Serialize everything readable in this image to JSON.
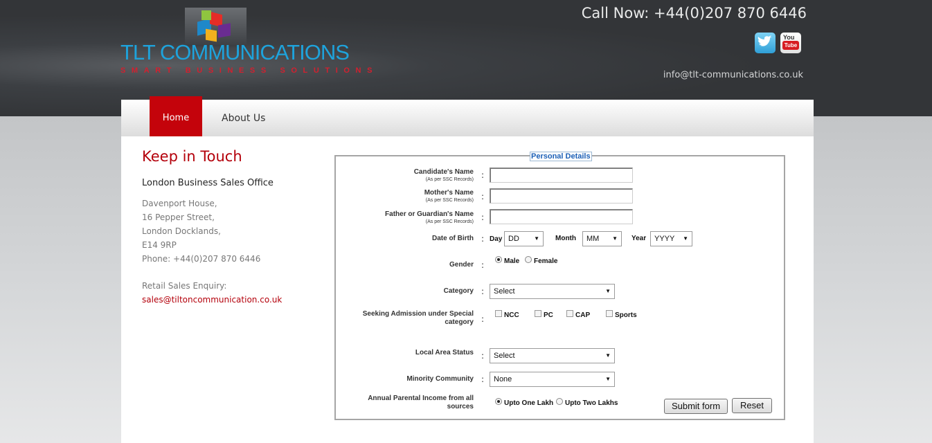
{
  "header": {
    "brand": "TLT COMMUNICATIONS",
    "tagline": "SMART BUSINESS SOLUTIONS",
    "call_now": "Call Now: +44(0)207 870 6446",
    "email": "info@tlt-communications.co.uk",
    "twitter_icon": "twitter-icon",
    "youtube_top": "You",
    "youtube_bottom": "Tube"
  },
  "nav": {
    "items": [
      {
        "label": "Home",
        "active": true
      },
      {
        "label": "About Us",
        "active": false
      }
    ]
  },
  "contact": {
    "title": "Keep in Touch",
    "office": "London Business Sales Office",
    "address": [
      "Davenport House,",
      "16 Pepper Street,",
      "London Docklands,",
      "E14 9RP",
      "Phone: +44(0)207 870 6446"
    ],
    "retail_label": "Retail Sales Enquiry:",
    "retail_email": "sales@tiltoncommunication.co.uk"
  },
  "form": {
    "legend": "Personal Details",
    "candidate_name": {
      "label": "Candidate's Name",
      "note": "(As per SSC Records)",
      "value": ""
    },
    "mother_name": {
      "label": "Mother's Name",
      "note": "(As per SSC Records)",
      "value": ""
    },
    "father_name": {
      "label": "Father or Guardian's Name",
      "note": "(As per SSC Records)",
      "value": ""
    },
    "dob": {
      "label": "Date of Birth",
      "day_label": "Day",
      "day_value": "DD",
      "month_label": "Month",
      "month_value": "MM",
      "year_label": "Year",
      "year_value": "YYYY"
    },
    "gender": {
      "label": "Gender",
      "options": [
        "Male",
        "Female"
      ],
      "selected": "Male"
    },
    "category": {
      "label": "Category",
      "value": "Select"
    },
    "special": {
      "label_line1": "Seeking Admission under Special",
      "label_line2": "category",
      "options": [
        "NCC",
        "PC",
        "CAP",
        "Sports"
      ]
    },
    "local_area": {
      "label": "Local Area Status",
      "value": "Select"
    },
    "minority": {
      "label": "Minority Community",
      "value": "None"
    },
    "income": {
      "label_line1": "Annual Parental Income from all",
      "label_line2": "sources",
      "options": [
        "Upto One Lakh",
        "Upto Two Lakhs"
      ],
      "selected": "Upto One Lakh"
    },
    "submit_label": "Submit form",
    "reset_label": "Reset",
    "colon": ":"
  }
}
